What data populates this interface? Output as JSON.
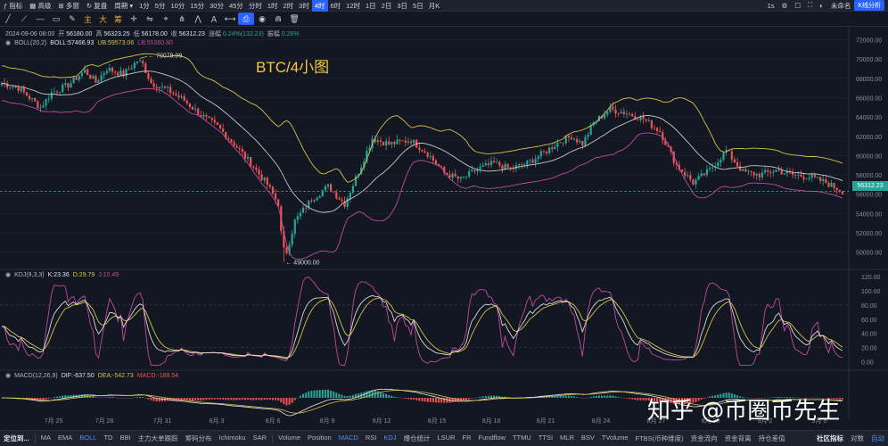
{
  "toolbar": {
    "indicator": "指标",
    "layout": "高级",
    "multi": "多窗",
    "review": "复盘",
    "period_label": "周期",
    "periods": [
      "1分",
      "5分",
      "10分",
      "15分",
      "30分",
      "45分",
      "分时",
      "1时",
      "2时",
      "3时",
      "4时",
      "6时",
      "12时",
      "1日",
      "2日",
      "3日",
      "5日",
      "月K"
    ],
    "active_period": "4时",
    "right_items": [
      "1s",
      "⚙",
      "☐",
      "⛶",
      "◐",
      "未命名"
    ],
    "kline_button": "K线分析"
  },
  "draw_tools": {
    "cn_labels": [
      "主",
      "大",
      "筹"
    ]
  },
  "main_legend": {
    "date": "2024-09-06 08:00",
    "open_label": "开",
    "open": "56180.00",
    "high_label": "高",
    "high": "56323.25",
    "low_label": "低",
    "low": "56178.00",
    "close_label": "收",
    "close": "56312.23",
    "change_label": "涨幅",
    "change": "0.24%(132.23)",
    "amp_label": "振幅",
    "amp": "0.26%",
    "boll_name": "BOLL(20,2)",
    "boll": "BOLL:57466.93",
    "ub": "UB:59573.06",
    "lb": "LB:55360.80"
  },
  "overlay_title": "BTC/4小图",
  "annotations": {
    "high": "70079.99",
    "low": "49000.00"
  },
  "price_axis": [
    "72000.00",
    "70000.00",
    "68000.00",
    "66000.00",
    "64000.00",
    "62000.00",
    "60000.00",
    "58000.00",
    "56000.00",
    "54000.00",
    "52000.00",
    "50000.00"
  ],
  "current_price": "56312.23",
  "kdj_legend": {
    "name": "KDJ(9,3,3)",
    "k": "K:23.36",
    "d": "D:29.79",
    "j": "J:10.49"
  },
  "kdj_axis": [
    "120.00",
    "100.00",
    "80.00",
    "60.00",
    "40.00",
    "20.00",
    "0.00"
  ],
  "macd_legend": {
    "name": "MACD(12,26,9)",
    "dif": "DIF:-637.50",
    "dea": "DEA:-542.73",
    "macd": "MACD:-189.54"
  },
  "time_axis": [
    "7月 25",
    "7月 28",
    "7月 31",
    "8月 3",
    "8月 6",
    "8月 9",
    "8月 12",
    "8月 15",
    "8月 18",
    "8月 21",
    "8月 24",
    "8月 27",
    "8月 30",
    "9月 2",
    "9月 5"
  ],
  "watermark": "知乎 @币圈币先生",
  "bottom": {
    "first": "定位到...",
    "main_inds": [
      "MA",
      "EMA",
      "BOLL",
      "TD",
      "BBI",
      "主力大单跟踪",
      "筹码分布",
      "Ichimoku",
      "SAR"
    ],
    "sub_inds": [
      "Volume",
      "Position",
      "MACD",
      "RSI",
      "KDJ",
      "爆仓统计",
      "LSUR",
      "FR",
      "Fundflow",
      "TTMU",
      "TTSI",
      "MLR",
      "BSV",
      "TVolume",
      "FTBS(币种维度)",
      "资金流向",
      "资金背离",
      "持仓差值"
    ],
    "active": [
      "BOLL",
      "MACD",
      "KDJ"
    ],
    "right": [
      "社区指标",
      "对数",
      "自动"
    ]
  },
  "colors": {
    "up": "#26a69a",
    "down": "#ef5350",
    "boll_mid": "#c8c8c8",
    "boll_ub": "#d6c14a",
    "boll_lb": "#c04aa0",
    "k": "#d8d8d8",
    "d": "#d6c14a",
    "j": "#c04aa0",
    "dif": "#e8e8e8",
    "dea": "#d6c14a",
    "accent": "#2962ff"
  }
}
